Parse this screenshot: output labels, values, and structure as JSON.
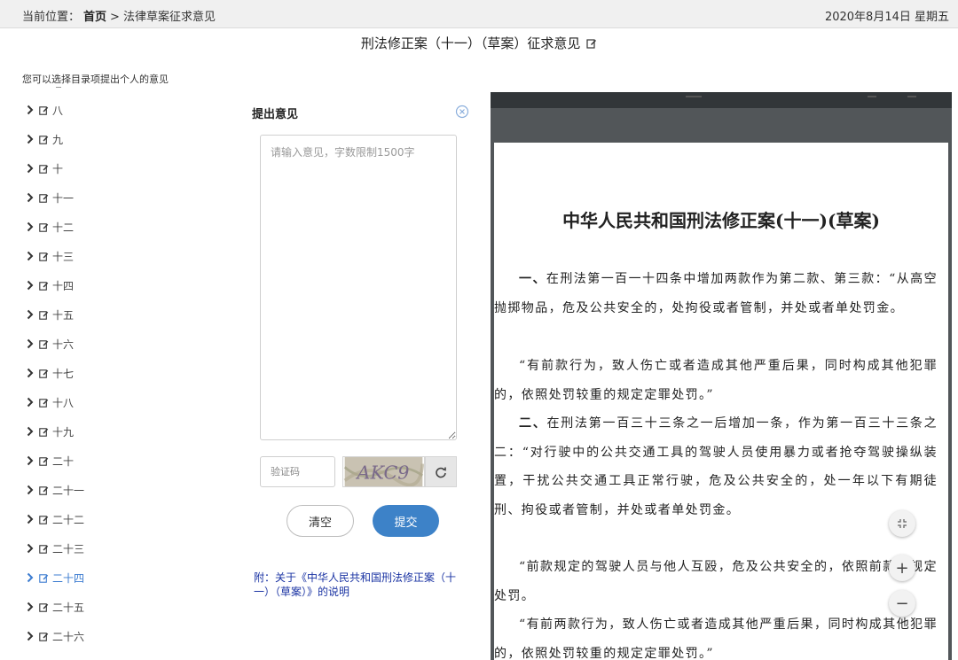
{
  "breadcrumb": {
    "prefix": "当前位置：",
    "home": "首页",
    "separator": ">",
    "current": "法律草案征求意见"
  },
  "date": "2020年8月14日 星期五",
  "page_title": "刑法修正案（十一）（草案）征求意见",
  "hint": "您可以选择目录项提出个人的意见",
  "toc": {
    "items": [
      {
        "label": "八"
      },
      {
        "label": "九"
      },
      {
        "label": "十"
      },
      {
        "label": "十一"
      },
      {
        "label": "十二"
      },
      {
        "label": "十三"
      },
      {
        "label": "十四"
      },
      {
        "label": "十五"
      },
      {
        "label": "十六"
      },
      {
        "label": "十七"
      },
      {
        "label": "十八"
      },
      {
        "label": "十九"
      },
      {
        "label": "二十"
      },
      {
        "label": "二十一"
      },
      {
        "label": "二十二"
      },
      {
        "label": "二十三"
      },
      {
        "label": "二十四",
        "active": true
      },
      {
        "label": "二十五"
      },
      {
        "label": "二十六"
      }
    ],
    "active_color": "#3b7bd0"
  },
  "opinion": {
    "title": "提出意见",
    "placeholder": "请输入意见，字数限制1500字",
    "captcha_placeholder": "验证码",
    "captcha_text": "AKC9",
    "clear_label": "清空",
    "submit_label": "提交",
    "explain_link": "附：关于《中华人民共和国刑法修正案（十一）（草案）》的说明",
    "submit_color": "#3d82c8",
    "link_color": "#1a33a3"
  },
  "document": {
    "title": "中华人民共和国刑法修正案(十一)(草案)",
    "p1_lead": "一、",
    "p1": "在刑法第一百一十四条中增加两款作为第二款、第三款：“从高空抛掷物品，危及公共安全的，处拘役或者管制，并处或者单处罚金。",
    "p2": "“有前款行为，致人伤亡或者造成其他严重后果，同时构成其他犯罪的，依照处罚较重的规定定罪处罚。”",
    "p3_lead": "二、",
    "p3": "在刑法第一百三十三条之一后增加一条，作为第一百三十三条之二：“对行驶中的公共交通工具的驾驶人员使用暴力或者抢夺驾驶操纵装置，干扰公共交通工具正常行驶，危及公共安全的，处一年以下有期徒刑、拘役或者管制，并处或者单处罚金。",
    "p4": "“前款规定的驾驶人员与他人互殴，危及公共安全的，依照前款的规定处罚。",
    "p5": "“有前两款行为，致人伤亡或者造成其他严重后果，同时构成其他犯罪的，依照处罚较重的规定定罪处罚。”"
  },
  "zoom": {
    "fit": "⇲",
    "in": "+",
    "out": "−"
  }
}
